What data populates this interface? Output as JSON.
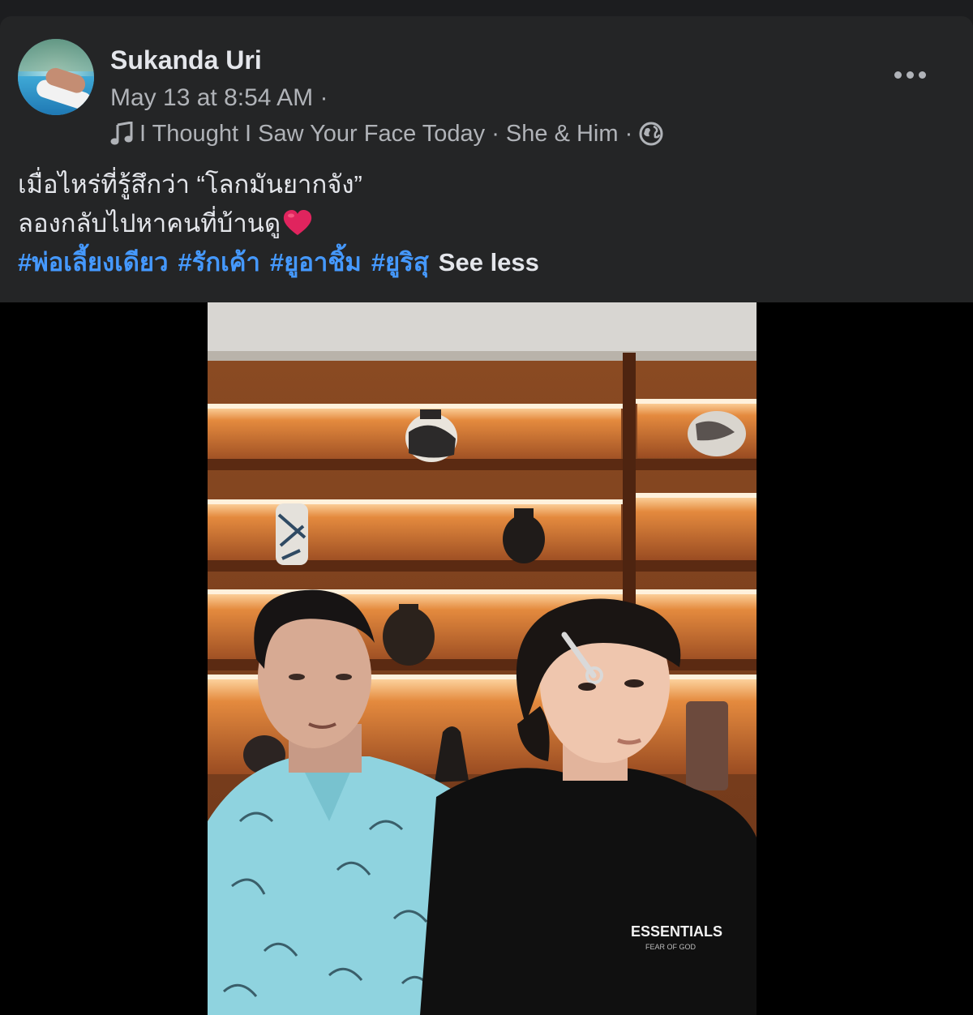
{
  "post": {
    "author": "Sukanda Uri",
    "timestamp": "May 13 at 8:54 AM ·",
    "music": "I Thought I Saw Your Face Today · She & Him ·",
    "audience_icon": "globe-icon",
    "more_icon": "more-options-icon",
    "caption_line1": "เมื่อไหร่ที่รู้สึกว่า “โลกมันยากจัง”",
    "caption_line2": "ลองกลับไปหาคนที่บ้านดู",
    "hashtags": [
      "#พ่อเลี้ยงเดียว",
      "#รักเค้า",
      "#ยูอาชิ้ม",
      "#ยูริสุ"
    ],
    "see_less": "See less",
    "shirt_text": "ESSENTIALS",
    "shirt_subtext": "FEAR OF GOD"
  },
  "colors": {
    "background": "#1c1d1f",
    "card": "#242526",
    "primary_text": "#e4e6eb",
    "secondary_text": "#b0b3b8",
    "link": "#4599ff",
    "heart": "#e0245e"
  }
}
